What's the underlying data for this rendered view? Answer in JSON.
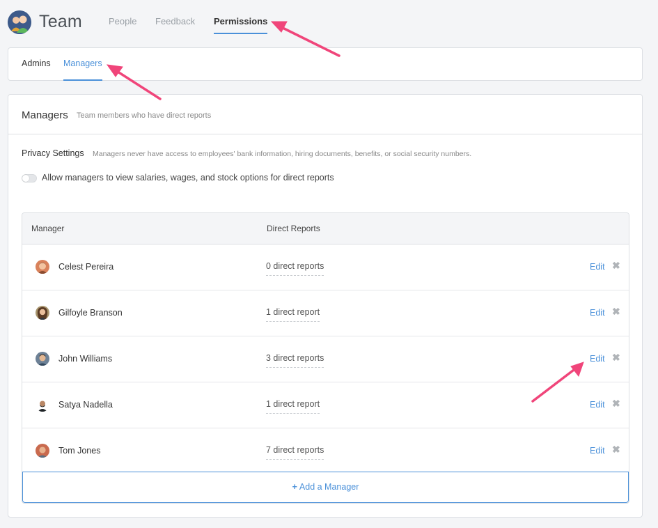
{
  "header": {
    "title": "Team",
    "tabs": [
      {
        "label": "People",
        "active": false
      },
      {
        "label": "Feedback",
        "active": false
      },
      {
        "label": "Permissions",
        "active": true
      }
    ]
  },
  "subnav": {
    "tabs": [
      {
        "label": "Admins",
        "active": false
      },
      {
        "label": "Managers",
        "active": true
      }
    ]
  },
  "section": {
    "title": "Managers",
    "subtitle": "Team members who have direct reports",
    "privacy_label": "Privacy Settings",
    "privacy_desc": "Managers never have access to employees' bank information, hiring documents, benefits, or social security numbers.",
    "toggle_label": "Allow managers to view salaries, wages, and stock options for direct reports",
    "toggle_on": false
  },
  "table": {
    "columns": [
      "Manager",
      "Direct Reports"
    ],
    "edit_label": "Edit",
    "remove_glyph": "✖",
    "rows": [
      {
        "name": "Celest Pereira",
        "reports": "0 direct reports"
      },
      {
        "name": "Gilfoyle Branson",
        "reports": "1 direct report"
      },
      {
        "name": "John Williams",
        "reports": "3 direct reports"
      },
      {
        "name": "Satya Nadella",
        "reports": "1 direct report"
      },
      {
        "name": "Tom Jones",
        "reports": "7 direct reports"
      }
    ],
    "add_label": "Add a Manager",
    "add_glyph": "+"
  },
  "colors": {
    "accent": "#4a90d9",
    "annotation": "#f0457a"
  }
}
